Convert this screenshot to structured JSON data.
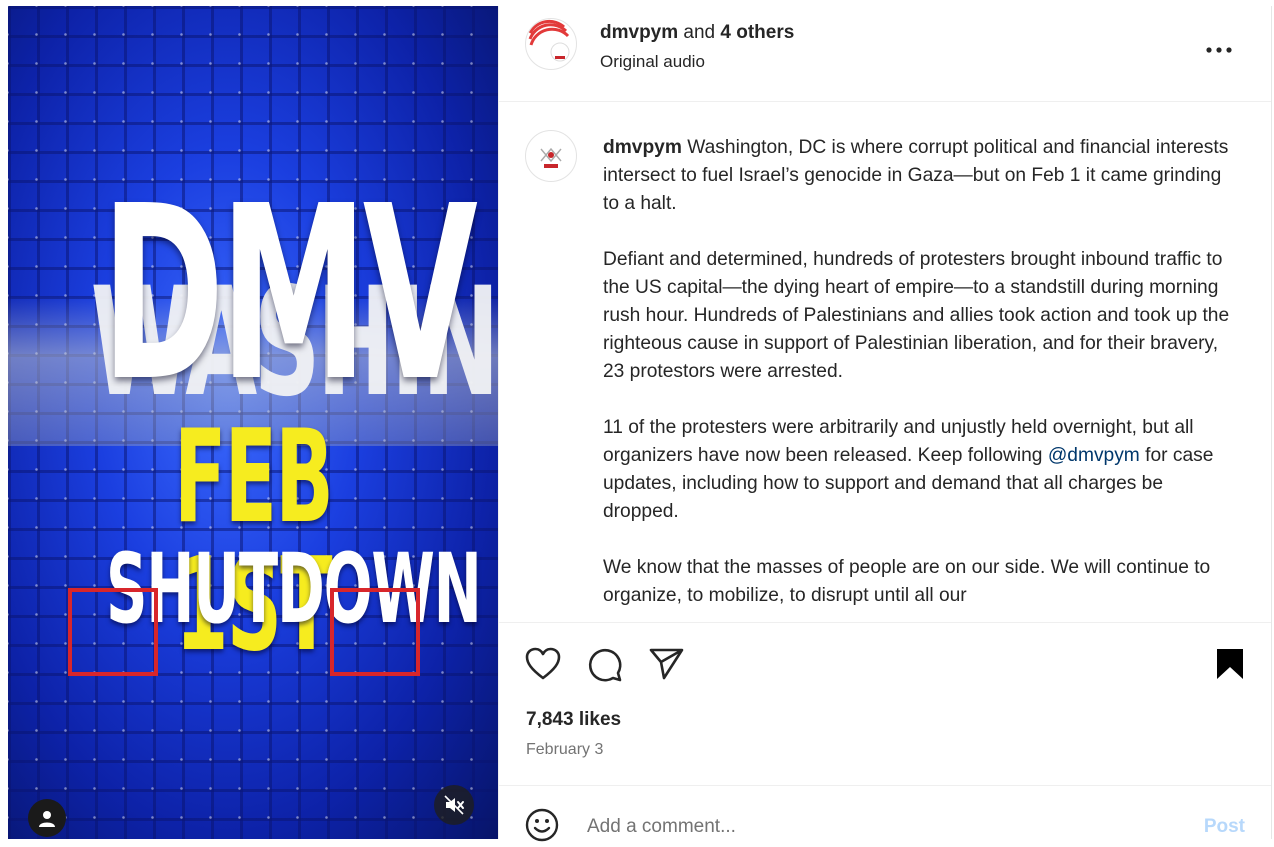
{
  "media": {
    "background_word": "WASHINGTO",
    "headline_big": "DMV",
    "headline_date": "FEB 1ST",
    "headline_event": "SHUTDOWN",
    "colors": {
      "blue": "#1b3fe0",
      "yellow": "#f6ec1f",
      "red": "#d8262b"
    },
    "icons": {
      "profile": "user-icon",
      "mute": "volume-muted-icon"
    }
  },
  "header": {
    "username": "dmvpym",
    "collab_joiner": " and ",
    "collab_others": "4 others",
    "audio": "Original audio",
    "more_icon": "more-horizontal-icon"
  },
  "caption": {
    "username": "dmvpym",
    "paragraph1": " Washington, DC is where corrupt political and financial interests intersect to fuel Israel’s genocide in Gaza—but on Feb 1 it came grinding to a halt.",
    "paragraph2": "Defiant and determined, hundreds of protesters brought inbound traffic to the US capital—the dying heart of empire—to a standstill during morning rush hour. Hundreds of Palestinians and allies took action and took up the righteous cause in support of Palestinian liberation, and for their bravery, 23 protestors were arrested.",
    "paragraph3_a": "11 of the protesters were arbitrarily and unjustly held overnight, but all organizers have now been released. Keep following ",
    "paragraph3_mention": "@dmvpym",
    "paragraph3_b": " for case updates, including how to support and demand that all charges be dropped.",
    "paragraph4": "We know that the masses of people are on our side. We will continue to organize, to mobilize, to disrupt until all our"
  },
  "actions": {
    "icons": [
      "heart-icon",
      "comment-icon",
      "share-icon",
      "bookmark-icon"
    ]
  },
  "likes": "7,843 likes",
  "date": "February 3",
  "comment": {
    "placeholder": "Add a comment...",
    "post_label": "Post",
    "emoji_icon": "emoji-icon"
  }
}
